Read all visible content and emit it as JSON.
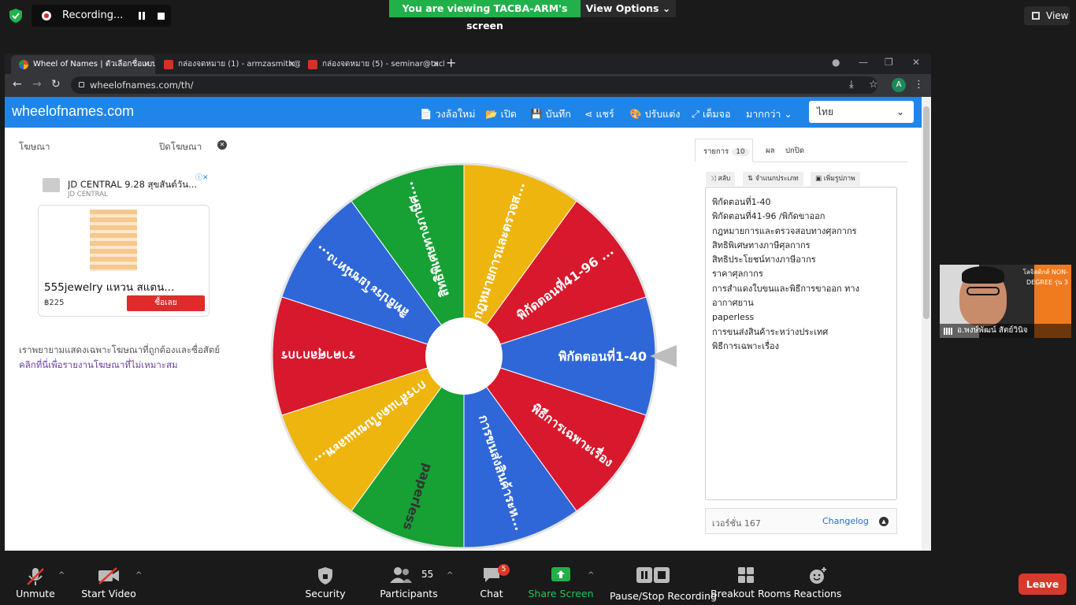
{
  "zoom_top": {
    "recording_label": "Recording...",
    "viewing_banner": "You are viewing TACBA-ARM's screen",
    "view_options": "View Options",
    "view_label": "View",
    "view_options_chevron": "⌄"
  },
  "browser": {
    "tabs": [
      {
        "title": "Wheel of Names | ตัวเลือกชื่อแบบสุ่ม",
        "color": "#e8453c"
      },
      {
        "title": "กล่องจดหมาย (1) - armzasmith@gmail",
        "color": "#d93025"
      },
      {
        "title": "กล่องจดหมาย (5) - seminar@tacba",
        "color": "#d93025"
      }
    ],
    "new_tab": "+",
    "close": "✕",
    "url": "wheelofnames.com/th/",
    "profile_initial": "A",
    "nav": {
      "back": "←",
      "forward": "→",
      "reload": "↻"
    },
    "window": {
      "minimize": "—",
      "restore": "❐",
      "close": "✕",
      "extensions": "●"
    },
    "tools": {
      "install": "⤓",
      "bookmark": "☆",
      "menu": "⋮"
    }
  },
  "site": {
    "brand": "wheelofnames.com",
    "nav": [
      {
        "icon": "📄",
        "label": "วงล้อใหม่"
      },
      {
        "icon": "📂",
        "label": "เปิด"
      },
      {
        "icon": "💾",
        "label": "บันทึก"
      },
      {
        "icon": "⋖",
        "label": "แชร์"
      },
      {
        "icon": "🎨",
        "label": "ปรับแต่ง"
      },
      {
        "icon": "⤢",
        "label": "เต็มจอ"
      },
      {
        "icon": "",
        "label": "มากกว่า ⌄"
      }
    ],
    "language": "ไทย",
    "language_chevron": "⌄"
  },
  "ad": {
    "label": "โฆษณา",
    "close_label": "ปิดโฆษณา",
    "close_icon": "✕",
    "adchoice": "ⓘ✕",
    "title": "JD CENTRAL 9.28 สุขสันต์วัน...",
    "subtitle": "JD CENTRAL",
    "product": "555jewelry แหวน สแตน...",
    "price": "฿225",
    "buy": "ซื้อเลย",
    "note1": "เราพยายามแสดงเฉพาะโฆษณาที่ถูกต้องและซื่อสัตย์",
    "note2": "คลิกที่นี่เพื่อรายงานโฆษณาที่ไม่เหมาะสม"
  },
  "wheel": {
    "segments": [
      {
        "label": "พิกัดตอนที่1-40",
        "color": "#2f67d8"
      },
      {
        "label": "พิธีการเฉพาะเรื่อง",
        "color": "#d8182c"
      },
      {
        "label": "การขนส่งสินค้าระห...",
        "color": "#2f67d8"
      },
      {
        "label": "paperless",
        "color": "#17a034"
      },
      {
        "label": "การสำแดงใบขนและพ...",
        "color": "#efb50f"
      },
      {
        "label": "ราคาศุลกากร",
        "color": "#d8182c"
      },
      {
        "label": "สิทธิประโยชน์ทาง...",
        "color": "#2f67d8"
      },
      {
        "label": "สิทธิพิเศษทางภาษีศ...",
        "color": "#17a034"
      },
      {
        "label": "กฎหมายการและตรวจส...",
        "color": "#efb50f"
      },
      {
        "label": "พิกัดตอนที่41-96 ...",
        "color": "#d8182c"
      }
    ]
  },
  "panel": {
    "tab_entries": "รายการ",
    "entries_count": "10",
    "tab_results": "ผล",
    "tab_hide": "ปกปิด",
    "btn_shuffle": "⤨ สลับ",
    "btn_sort": "⇅ จำแนกประเภท",
    "btn_image": "▣ เพิ่มรูปภาพ",
    "entries": [
      "พิกัดตอนที่1-40",
      "พิกัดตอนที่41-96 /พิกัดขาออก",
      "กฎหมายการและตรวจสอบทางศุลกากร",
      "สิทธิพิเศษทางภาษีศุลกากร",
      "สิทธิประโยชน์ทางภาษีอากร",
      "ราคาศุลกากร",
      "การสำแดงใบขนและพิธีการขาออก ทาง",
      "อากาศยาน",
      "paperless",
      "การขนส่งสินค้าระหว่างประเทศ",
      "พิธีการเฉพาะเรื่อง"
    ],
    "version": "เวอร์ชั่น 167",
    "changelog": "Changelog",
    "changelog_icon": "▲"
  },
  "video": {
    "name": "อ.พงษ์พัฒน์ สัตย์วินิจ",
    "corner": "โลจิสติกส์ NON-DEGREE รุ่น 3"
  },
  "zoom_bottom": {
    "mute": "Unmute",
    "video": "Start Video",
    "security": "Security",
    "participants": "Participants",
    "participants_count": "55",
    "chat": "Chat",
    "chat_badge": "5",
    "share": "Share Screen",
    "recording": "Pause/Stop Recording",
    "breakout": "Breakout Rooms",
    "reactions": "Reactions",
    "leave": "Leave",
    "caret": "^"
  }
}
